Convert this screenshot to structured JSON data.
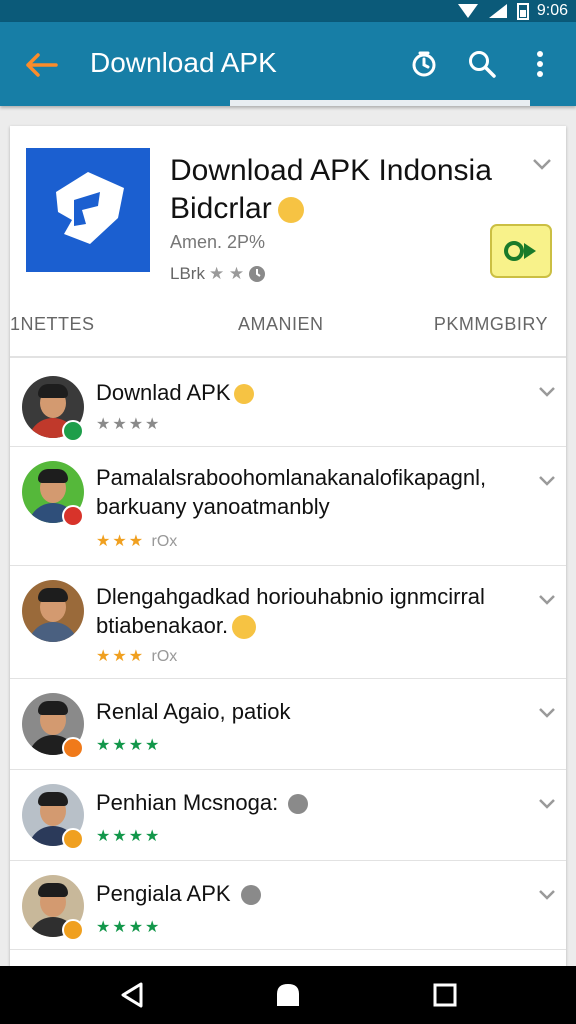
{
  "status_bar": {
    "time": "9:06"
  },
  "app_bar": {
    "title": "Download APK",
    "back_icon": "arrow-back-icon",
    "actions": [
      "history-icon",
      "search-icon",
      "more-vert-icon"
    ]
  },
  "app": {
    "name": "Download APK Indonsia Bidcrlar",
    "meta": "Amen. 2P%",
    "rating_label": "LBrk",
    "stars": "★ ★",
    "install_icon": "play-icon",
    "colors": {
      "icon_bg": "#1b5fd0",
      "install_bg": "#f8f28a",
      "accent": "#177ea6"
    }
  },
  "tabs": [
    "1NETTES",
    "AMANIEN",
    "PKMMGBIRY"
  ],
  "list": [
    {
      "title_line1": "Downlad APK",
      "title_line2": "",
      "stars": "★★★★",
      "extra": "",
      "star_color": "#8a8a8a",
      "badge_color": "#1e9e4a"
    },
    {
      "title_line1": "Pamalalsraboohomlanakanalofikapagnl,",
      "title_line2": "barkuany yanoatmanbly",
      "stars": "★★★",
      "extra": "rOx",
      "star_color": "#f0a020",
      "badge_color": "#d8332a"
    },
    {
      "title_line1": "Dlengahgadkad horiouhabnio ignmcirral",
      "title_line2": "btiabenakaor.",
      "stars": "★★★",
      "extra": "rOx",
      "star_color": "#f0a020",
      "badge_color": ""
    },
    {
      "title_line1": "Renlal Agaio, patiok",
      "title_line2": "",
      "stars": "★★★★",
      "extra": "",
      "star_color": "#12974a",
      "badge_color": "#f07a1a"
    },
    {
      "title_line1": "Penhian Mcsnoga:",
      "title_line2": "",
      "stars": "★★★★",
      "extra": "",
      "star_color": "#12974a",
      "badge_color": "#f0a020"
    },
    {
      "title_line1": "Pengiala APK",
      "title_line2": "",
      "stars": "★★★★",
      "extra": "",
      "star_color": "#12974a",
      "badge_color": "#f0a020"
    }
  ],
  "nav_bar": [
    "back-triangle-icon",
    "home-circle-icon",
    "recents-square-icon"
  ]
}
